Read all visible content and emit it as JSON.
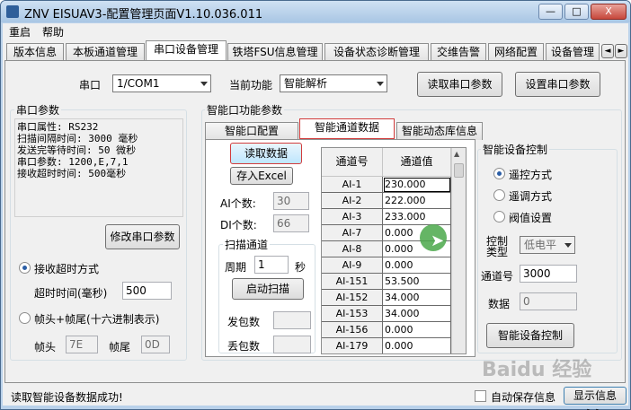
{
  "window": {
    "title": "ZNV EISUAV3-配置管理页面V1.10.036.011",
    "minimize": "—",
    "maximize": "□",
    "close": "X"
  },
  "menu": [
    "重启",
    "帮助"
  ],
  "tabs": [
    "版本信息",
    "本板通道管理",
    "串口设备管理",
    "铁塔FSU信息管理",
    "设备状态诊断管理",
    "交维告警",
    "网络配置",
    "设备管理"
  ],
  "tab_scroll": [
    "◄",
    "►"
  ],
  "top": {
    "serial_label": "串口",
    "serial_value": "1/COM1",
    "func_label": "当前功能",
    "func_value": "智能解析",
    "read_btn": "读取串口参数",
    "set_btn": "设置串口参数"
  },
  "serial_params": {
    "title": "串口参数",
    "lines": [
      "串口属性: RS232",
      "扫描间隔时间: 3000 毫秒",
      "发送完等待时间: 50 微秒",
      "串口参数: 1200,E,7,1",
      "接收超时时间: 500毫秒"
    ],
    "modify_btn": "修改串口参数",
    "radio_timeout": "接收超时方式",
    "timeout_label": "超时时间(毫秒)",
    "timeout_value": "500",
    "radio_frame": "帧头+帧尾(十六进制表示)",
    "head_label": "帧头",
    "head_value": "7E",
    "tail_label": "帧尾",
    "tail_value": "0D"
  },
  "smart": {
    "title": "智能口功能参数",
    "subtabs": [
      "智能口配置",
      "智能通道数据",
      "智能动态库信息"
    ],
    "read_btn": "读取数据",
    "save_btn": "存入Excel",
    "ai_label": "AI个数:",
    "ai_value": "30",
    "di_label": "DI个数:",
    "di_value": "66",
    "scan_title": "扫描通道",
    "period_label": "周期",
    "period_value": "1",
    "period_unit": "秒",
    "start_btn": "启动扫描",
    "send_label": "发包数",
    "lost_label": "丢包数",
    "table_headers": [
      "通道号",
      "通道值"
    ],
    "rows": [
      [
        "AI-1",
        "230.000"
      ],
      [
        "AI-2",
        "222.000"
      ],
      [
        "AI-3",
        "233.000"
      ],
      [
        "AI-7",
        "0.000"
      ],
      [
        "AI-8",
        "0.000"
      ],
      [
        "AI-9",
        "0.000"
      ],
      [
        "AI-151",
        "53.500"
      ],
      [
        "AI-152",
        "34.000"
      ],
      [
        "AI-153",
        "34.000"
      ],
      [
        "AI-156",
        "0.000"
      ],
      [
        "AI-179",
        "0.000"
      ]
    ]
  },
  "control": {
    "title": "智能设备控制",
    "radio1": "遥控方式",
    "radio2": "遥调方式",
    "radio3": "阀值设置",
    "type_label": "控制类型",
    "type_value": "低电平",
    "ch_label": "通道号",
    "ch_value": "3000",
    "data_label": "数据",
    "data_value": "0",
    "btn": "智能设备控制"
  },
  "status": {
    "message": "读取智能设备数据成功!",
    "autosave": "自动保存信息",
    "show_btn": "显示信息>>"
  },
  "watermark": "Baidu 经验"
}
